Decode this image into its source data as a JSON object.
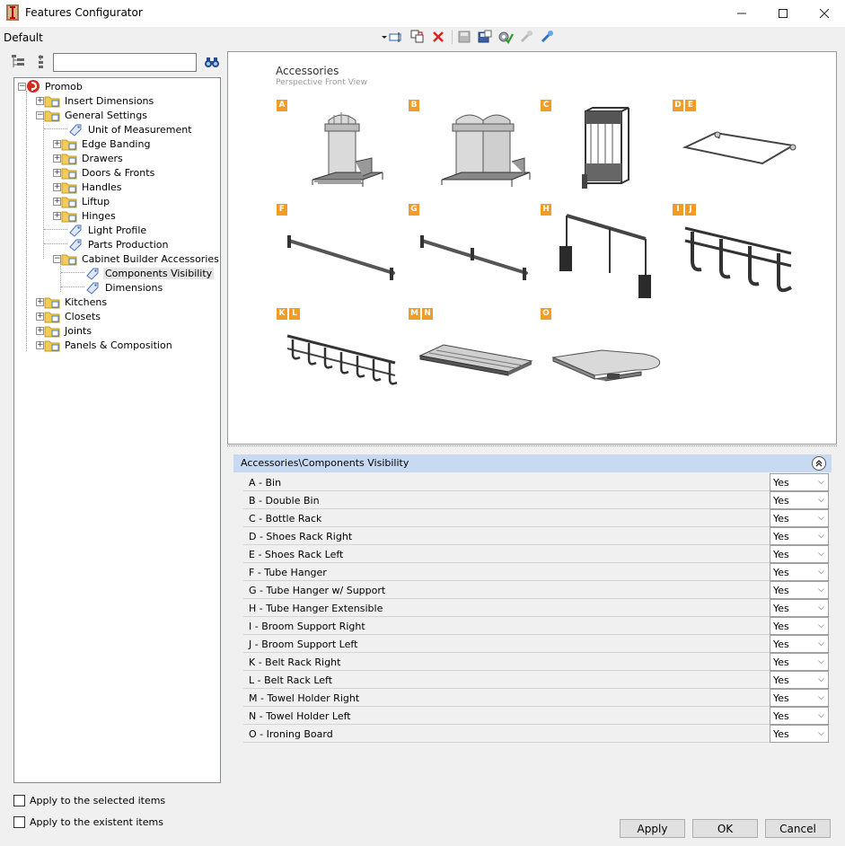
{
  "window": {
    "title": "Features Configurator"
  },
  "toolbar": {
    "profile": "Default"
  },
  "search": {
    "value": "",
    "placeholder": ""
  },
  "tree": {
    "root": "Promob",
    "nodes": [
      {
        "label": "Insert Dimensions"
      },
      {
        "label": "General Settings"
      },
      {
        "label": "Unit of Measurement"
      },
      {
        "label": "Edge Banding"
      },
      {
        "label": "Drawers"
      },
      {
        "label": "Doors & Fronts"
      },
      {
        "label": "Handles"
      },
      {
        "label": "Liftup"
      },
      {
        "label": "Hinges"
      },
      {
        "label": "Light Profile"
      },
      {
        "label": "Parts Production"
      },
      {
        "label": "Cabinet Builder Accessories"
      },
      {
        "label": "Components Visibility"
      },
      {
        "label": "Dimensions"
      },
      {
        "label": "Kitchens"
      },
      {
        "label": "Closets"
      },
      {
        "label": "Joints"
      },
      {
        "label": "Panels & Composition"
      }
    ]
  },
  "options": {
    "apply_selected": "Apply to the selected items",
    "apply_existent": "Apply to the existent items"
  },
  "preview": {
    "title": "Accessories",
    "subtitle": "Perspective Front View",
    "tags": {
      "a": "A",
      "b": "B",
      "c": "C",
      "d": "D",
      "e": "E",
      "f": "F",
      "g": "G",
      "h": "H",
      "i": "I",
      "j": "J",
      "k": "K",
      "l": "L",
      "m": "M",
      "n": "N",
      "o": "O"
    }
  },
  "grid": {
    "title": "Accessories\\Components Visibility",
    "rows": [
      {
        "name": "A -  Bin",
        "value": "Yes"
      },
      {
        "name": "B -  Double Bin",
        "value": "Yes"
      },
      {
        "name": "C -  Bottle Rack",
        "value": "Yes"
      },
      {
        "name": "D -  Shoes Rack Right",
        "value": "Yes"
      },
      {
        "name": "E -  Shoes Rack Left",
        "value": "Yes"
      },
      {
        "name": "F -  Tube Hanger",
        "value": "Yes"
      },
      {
        "name": "G -  Tube Hanger w/ Support",
        "value": "Yes"
      },
      {
        "name": "H -  Tube Hanger Extensible",
        "value": "Yes"
      },
      {
        "name": "I -  Broom Support Right",
        "value": "Yes"
      },
      {
        "name": "J -  Broom Support Left",
        "value": "Yes"
      },
      {
        "name": "K -  Belt Rack Right",
        "value": "Yes"
      },
      {
        "name": "L -  Belt Rack Left",
        "value": "Yes"
      },
      {
        "name": "M -  Towel Holder Right",
        "value": "Yes"
      },
      {
        "name": "N -  Towel Holder Left",
        "value": "Yes"
      },
      {
        "name": "O -  Ironing Board",
        "value": "Yes"
      }
    ]
  },
  "buttons": {
    "apply": "Apply",
    "ok": "OK",
    "cancel": "Cancel"
  }
}
